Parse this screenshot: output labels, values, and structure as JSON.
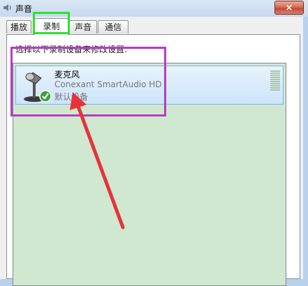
{
  "window": {
    "title": "声音",
    "icon": "speaker-icon",
    "close_label": "×"
  },
  "tabs": [
    {
      "label": "播放",
      "selected": false
    },
    {
      "label": "录制",
      "selected": true
    },
    {
      "label": "声音",
      "selected": false
    },
    {
      "label": "通信",
      "selected": false
    }
  ],
  "main": {
    "instruction": "选择以下录制设备来修改设置:",
    "devices": [
      {
        "name": "麦克风",
        "driver": "Conexant SmartAudio HD",
        "status": "默认设备",
        "icon": "microphone-icon",
        "badge": "default-check-icon",
        "selected": true
      }
    ]
  },
  "annotations": {
    "tab_highlight_color": "#2fe02f",
    "device_highlight_color": "#b73cc2",
    "arrow_color": "#e8323a"
  },
  "colors": {
    "list_background": "#cfe8cf",
    "selection_border": "#7fb1e8"
  }
}
